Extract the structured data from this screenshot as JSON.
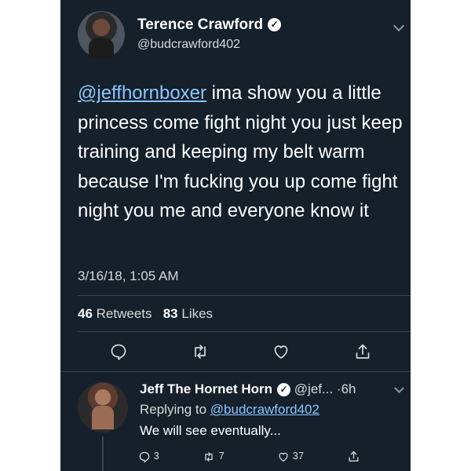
{
  "tweet": {
    "name": "Terence Crawford",
    "handle": "@budcrawford402",
    "mention": "@jeffhornboxer",
    "text": " ima show you a little princess come fight night you just keep training and keeping my belt warm because I'm fucking you up come fight night you me and everyone know it",
    "date": "3/16/18, 1:05 AM",
    "retweets_count": "46",
    "retweets_label": "Retweets",
    "likes_count": "83",
    "likes_label": "Likes"
  },
  "reply": {
    "name": "Jeff The Hornet Horn",
    "handle_time": "@jef... ·6h",
    "replying_prefix": "Replying to ",
    "replying_to": "@budcrawford402",
    "text": "We will see eventually...",
    "reply_count": "3",
    "retweet_count": "7",
    "like_count": "37"
  },
  "icons": [
    "verified-badge-icon",
    "chevron-down-icon",
    "reply-icon",
    "retweet-icon",
    "like-icon",
    "share-icon"
  ],
  "colors": {
    "background": "#15202b",
    "text": "#ffffff",
    "secondary": "#d6d9db",
    "link": "#8cc5ff",
    "divider": "#38444d"
  }
}
